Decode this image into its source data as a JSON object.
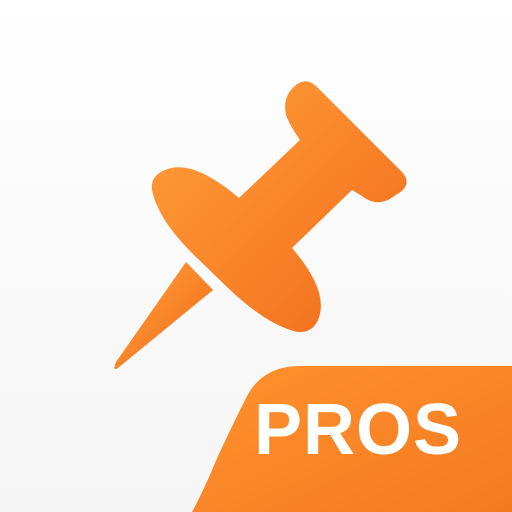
{
  "badge": {
    "label": "PROS"
  },
  "icon": {
    "name": "pushpin-icon"
  },
  "colors": {
    "accent_light": "#FF9A2E",
    "accent_dark": "#F26A1B",
    "background": "#FFFFFF"
  }
}
